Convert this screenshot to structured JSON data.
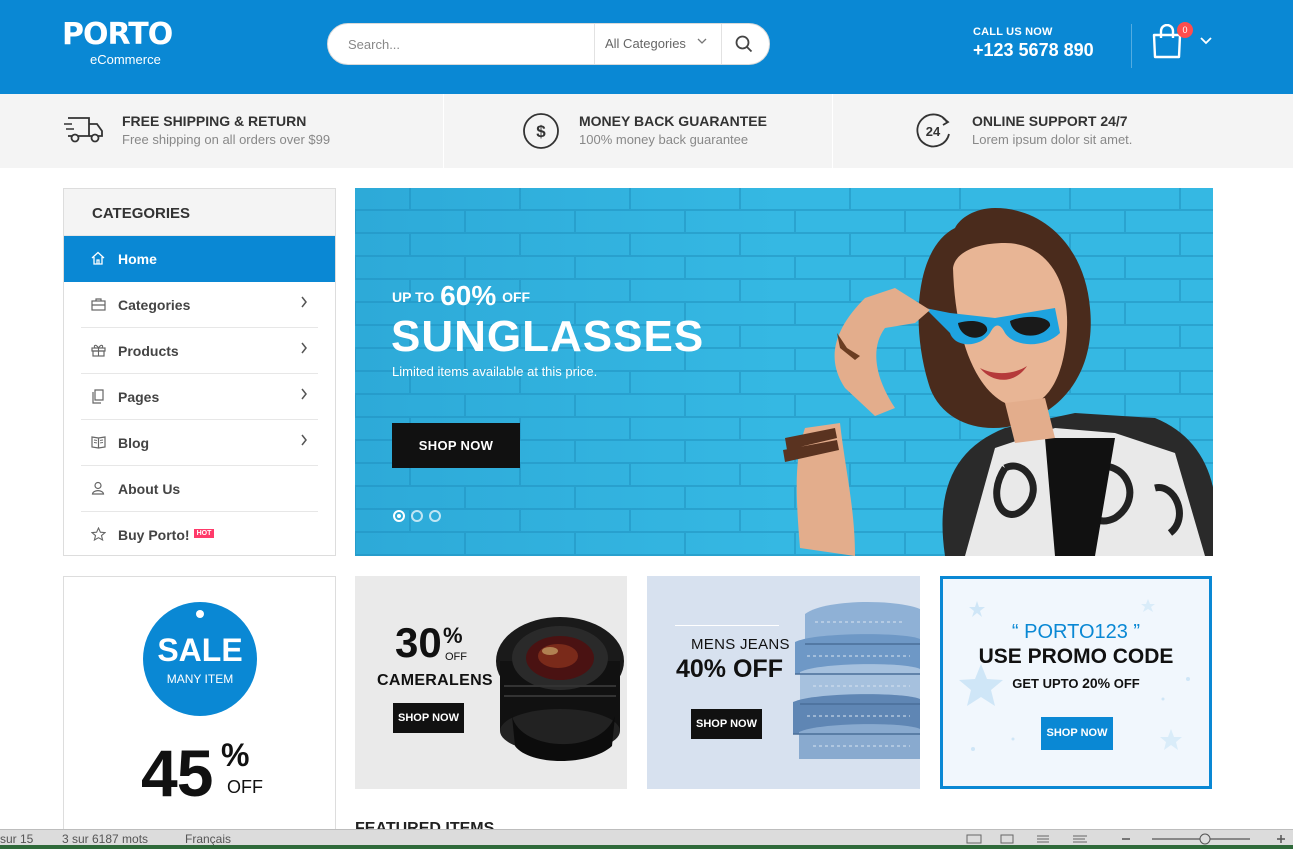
{
  "header": {
    "logo_main": "PORTO",
    "logo_sub": "eCommerce",
    "search_placeholder": "Search...",
    "search_category": "All Categories",
    "call_label": "CALL US NOW",
    "call_phone": "+123 5678 890",
    "cart_count": "0"
  },
  "info": [
    {
      "title": "FREE SHIPPING & RETURN",
      "subtitle": "Free shipping on all orders over $99",
      "icon": "truck-icon"
    },
    {
      "title": "MONEY BACK GUARANTEE",
      "subtitle": "100% money back guarantee",
      "icon": "dollar-circle-icon"
    },
    {
      "title": "ONLINE SUPPORT 24/7",
      "subtitle": "Lorem ipsum dolor sit amet.",
      "icon": "support-24-icon"
    }
  ],
  "sidebar": {
    "title": "CATEGORIES",
    "items": [
      {
        "label": "Home",
        "icon": "home-icon"
      },
      {
        "label": "Categories",
        "icon": "briefcase-icon"
      },
      {
        "label": "Products",
        "icon": "gift-icon"
      },
      {
        "label": "Pages",
        "icon": "pages-icon"
      },
      {
        "label": "Blog",
        "icon": "book-icon"
      },
      {
        "label": "About Us",
        "icon": "user-icon"
      },
      {
        "label": "Buy Porto!",
        "icon": "star-icon",
        "badge": "HOT"
      }
    ]
  },
  "hero": {
    "up_to": "UP TO",
    "percent": "60%",
    "off": "OFF",
    "title": "SUNGLASSES",
    "subtitle": "Limited items available at this price.",
    "button": "SHOP NOW",
    "active_slide": 1,
    "slides": 3
  },
  "sale": {
    "word": "SALE",
    "many": "MANY ITEM",
    "percent": "45",
    "sign": "%",
    "off": "OFF"
  },
  "banners": {
    "camera": {
      "percent": "30",
      "sign": "%",
      "off": "OFF",
      "label": "CAMERALENS",
      "button": "SHOP NOW"
    },
    "jeans": {
      "line1": "MENS JEANS",
      "line2": "40% OFF",
      "button": "SHOP NOW"
    },
    "promo": {
      "code": "“ PORTO123 ”",
      "use": "USE PROMO CODE",
      "get": "GET UPTO",
      "get_pct": "20%",
      "get_off": "OFF",
      "button": "SHOP NOW"
    }
  },
  "featured_title": "FEATURED ITEMS",
  "statusbar": {
    "page": "sur 15",
    "words": "3 sur 6187 mots",
    "lang": "Français"
  },
  "colors": {
    "primary": "#0a88d4",
    "hero_bg": "#2fb4e1",
    "hot": "#ff3a6a"
  }
}
